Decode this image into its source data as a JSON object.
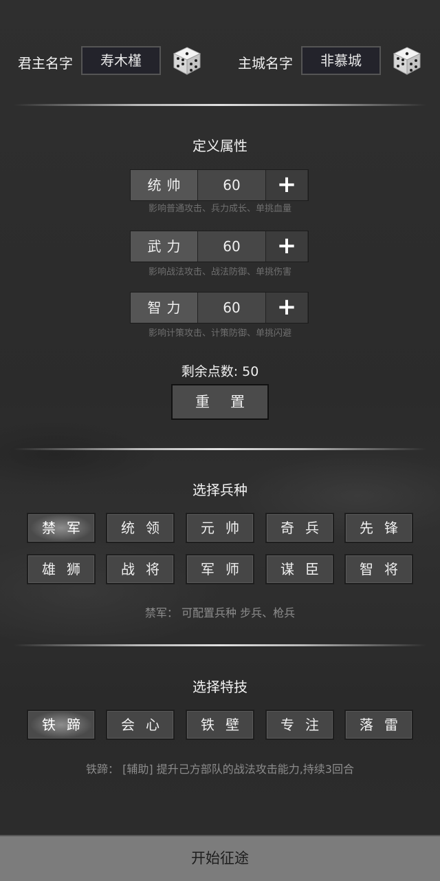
{
  "header": {
    "lord_label": "君主名字",
    "lord_name": "寿木槿",
    "city_label": "主城名字",
    "city_name": "非慕城",
    "dice_icon": "dice-icon"
  },
  "attributes": {
    "title": "定义属性",
    "items": [
      {
        "name": "统帅",
        "value": "60",
        "plus": "+",
        "desc": "影响普通攻击、兵力成长、单挑血量"
      },
      {
        "name": "武力",
        "value": "60",
        "plus": "+",
        "desc": "影响战法攻击、战法防御、单挑伤害"
      },
      {
        "name": "智力",
        "value": "60",
        "plus": "+",
        "desc": "影响计策攻击、计策防御、单挑闪避"
      }
    ],
    "remaining_label": "剩余点数: 50",
    "reset_label": "重置"
  },
  "troops": {
    "title": "选择兵种",
    "items": [
      "禁军",
      "统领",
      "元帅",
      "奇兵",
      "先锋",
      "雄狮",
      "战将",
      "军师",
      "谋臣",
      "智将"
    ],
    "selected_index": 0,
    "description": "禁军：  可配置兵种  步兵、枪兵"
  },
  "skills": {
    "title": "选择特技",
    "items": [
      "铁蹄",
      "会心",
      "铁壁",
      "专注",
      "落雷"
    ],
    "selected_index": 0,
    "description": "铁蹄：  [辅助] 提升己方部队的战法攻击能力,持续3回合"
  },
  "footer": {
    "start_label": "开始征途"
  },
  "colors": {
    "background": "#2d2d2d",
    "button": "#464646",
    "selected": "#8d8d8d",
    "footer": "#7c7c7c"
  }
}
